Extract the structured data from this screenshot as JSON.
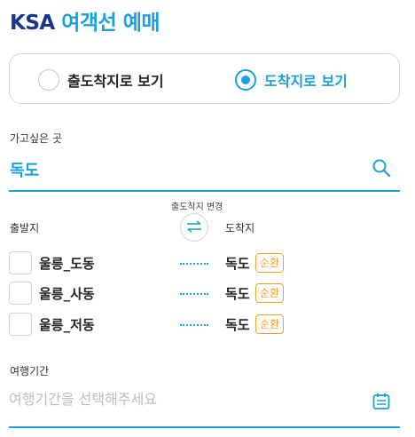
{
  "header": {
    "brand": "KSA",
    "title_rest": "여객선 예매"
  },
  "mode": {
    "options": [
      {
        "label": "출도착지로 보기",
        "selected": false
      },
      {
        "label": "도착지로 보기",
        "selected": true
      }
    ]
  },
  "destination": {
    "label": "가고싶은 곳",
    "value": "독도",
    "icon": "search-icon"
  },
  "swap": {
    "label": "출도착지 변경",
    "icon": "swap-arrows-icon"
  },
  "columns": {
    "departure": "출발지",
    "arrival": "도착지"
  },
  "routes": [
    {
      "from": "울릉_도동",
      "to": "독도",
      "badge": "순환",
      "checked": false
    },
    {
      "from": "울릉_사동",
      "to": "독도",
      "badge": "순환",
      "checked": false
    },
    {
      "from": "울릉_저동",
      "to": "독도",
      "badge": "순환",
      "checked": false
    }
  ],
  "period": {
    "label": "여행기간",
    "placeholder": "여행기간을 선택해주세요",
    "icon": "calendar-icon"
  },
  "colors": {
    "brand": "#16358c",
    "accent": "#1aa0dc",
    "badge": "#f0a030",
    "border": "#d6d9de"
  }
}
